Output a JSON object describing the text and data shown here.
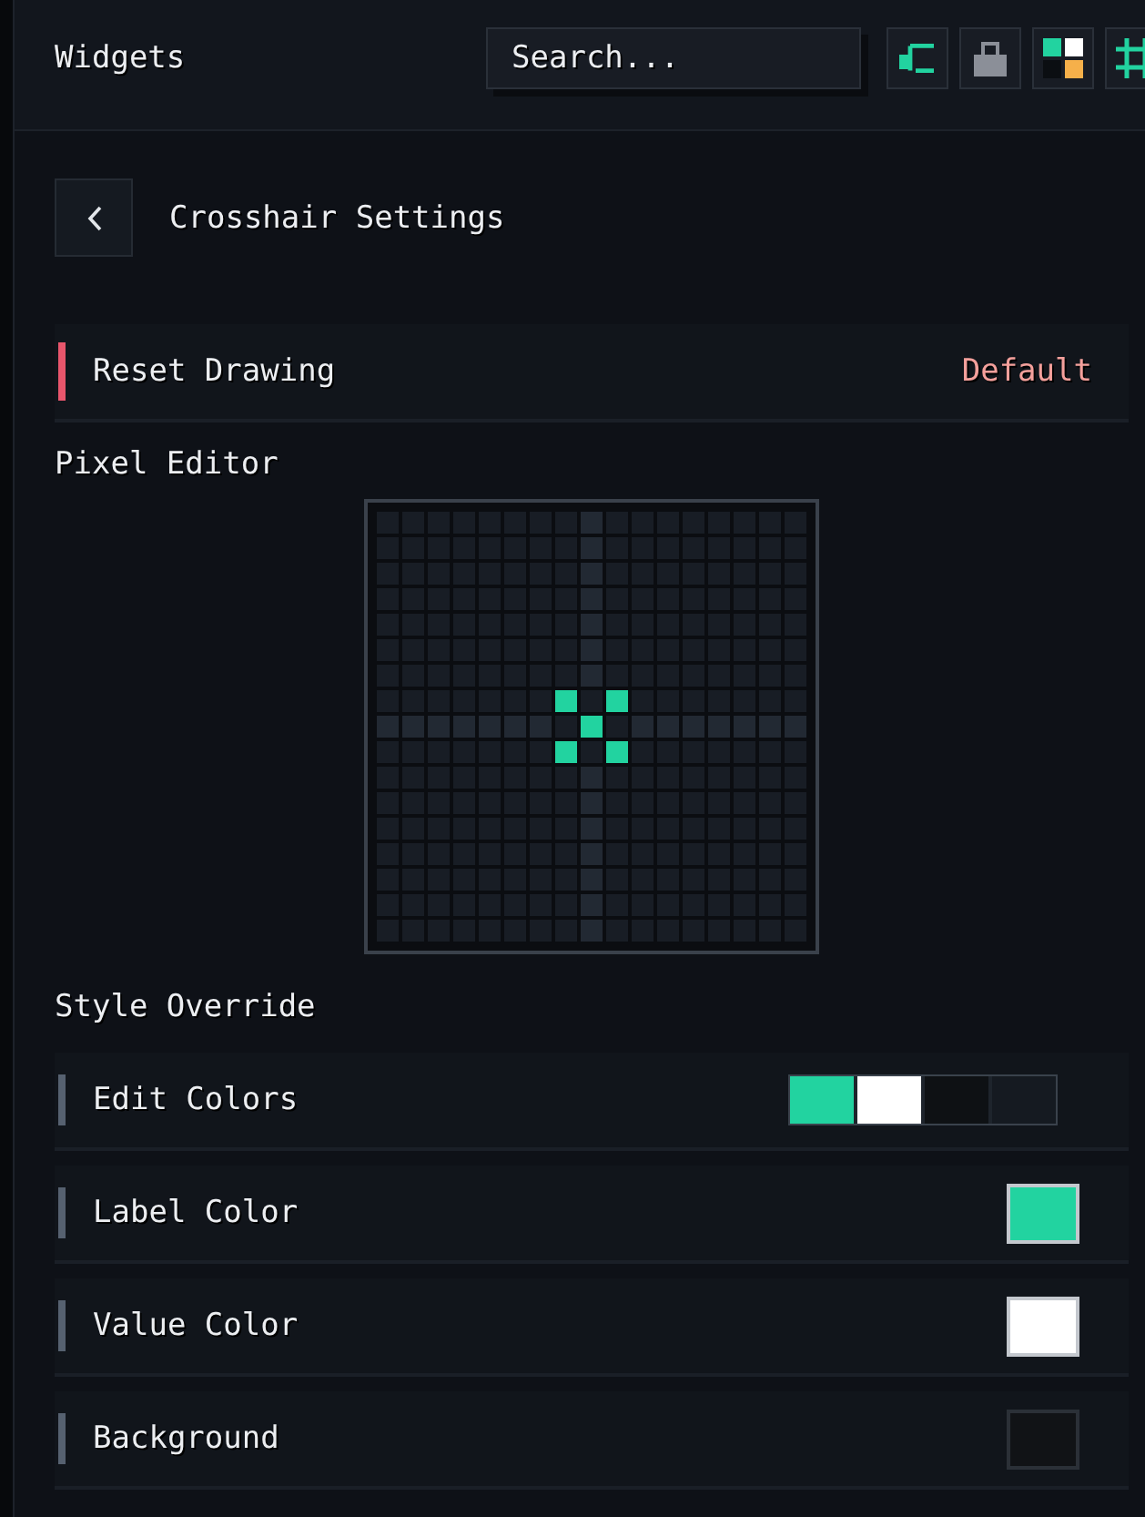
{
  "header": {
    "title": "Widgets",
    "search": {
      "placeholder": "Search..."
    },
    "tools": [
      {
        "kind": "connector"
      },
      {
        "kind": "lock"
      },
      {
        "kind": "tiles"
      },
      {
        "kind": "grid"
      }
    ]
  },
  "page": {
    "title": "Crosshair Settings"
  },
  "reset_row": {
    "label": "Reset Drawing",
    "action": "Default"
  },
  "pixel_editor": {
    "label": "Pixel Editor",
    "rows": [
      {
        "cells": [
          {
            "on": false
          },
          {
            "on": false
          },
          {
            "on": false
          },
          {
            "on": false
          },
          {
            "on": false
          },
          {
            "on": false
          },
          {
            "on": false
          },
          {
            "on": false
          },
          {
            "on": false
          },
          {
            "on": false
          },
          {
            "on": false
          },
          {
            "on": false
          },
          {
            "on": false
          },
          {
            "on": false
          },
          {
            "on": false
          },
          {
            "on": false
          },
          {
            "on": false
          }
        ]
      },
      {
        "cells": [
          {
            "on": false
          },
          {
            "on": false
          },
          {
            "on": false
          },
          {
            "on": false
          },
          {
            "on": false
          },
          {
            "on": false
          },
          {
            "on": false
          },
          {
            "on": false
          },
          {
            "on": false
          },
          {
            "on": false
          },
          {
            "on": false
          },
          {
            "on": false
          },
          {
            "on": false
          },
          {
            "on": false
          },
          {
            "on": false
          },
          {
            "on": false
          },
          {
            "on": false
          }
        ]
      },
      {
        "cells": [
          {
            "on": false
          },
          {
            "on": false
          },
          {
            "on": false
          },
          {
            "on": false
          },
          {
            "on": false
          },
          {
            "on": false
          },
          {
            "on": false
          },
          {
            "on": false
          },
          {
            "on": false
          },
          {
            "on": false
          },
          {
            "on": false
          },
          {
            "on": false
          },
          {
            "on": false
          },
          {
            "on": false
          },
          {
            "on": false
          },
          {
            "on": false
          },
          {
            "on": false
          }
        ]
      },
      {
        "cells": [
          {
            "on": false
          },
          {
            "on": false
          },
          {
            "on": false
          },
          {
            "on": false
          },
          {
            "on": false
          },
          {
            "on": false
          },
          {
            "on": false
          },
          {
            "on": false
          },
          {
            "on": false
          },
          {
            "on": false
          },
          {
            "on": false
          },
          {
            "on": false
          },
          {
            "on": false
          },
          {
            "on": false
          },
          {
            "on": false
          },
          {
            "on": false
          },
          {
            "on": false
          }
        ]
      },
      {
        "cells": [
          {
            "on": false
          },
          {
            "on": false
          },
          {
            "on": false
          },
          {
            "on": false
          },
          {
            "on": false
          },
          {
            "on": false
          },
          {
            "on": false
          },
          {
            "on": false
          },
          {
            "on": false
          },
          {
            "on": false
          },
          {
            "on": false
          },
          {
            "on": false
          },
          {
            "on": false
          },
          {
            "on": false
          },
          {
            "on": false
          },
          {
            "on": false
          },
          {
            "on": false
          }
        ]
      },
      {
        "cells": [
          {
            "on": false
          },
          {
            "on": false
          },
          {
            "on": false
          },
          {
            "on": false
          },
          {
            "on": false
          },
          {
            "on": false
          },
          {
            "on": false
          },
          {
            "on": false
          },
          {
            "on": false
          },
          {
            "on": false
          },
          {
            "on": false
          },
          {
            "on": false
          },
          {
            "on": false
          },
          {
            "on": false
          },
          {
            "on": false
          },
          {
            "on": false
          },
          {
            "on": false
          }
        ]
      },
      {
        "cells": [
          {
            "on": false
          },
          {
            "on": false
          },
          {
            "on": false
          },
          {
            "on": false
          },
          {
            "on": false
          },
          {
            "on": false
          },
          {
            "on": false
          },
          {
            "on": false
          },
          {
            "on": false
          },
          {
            "on": false
          },
          {
            "on": false
          },
          {
            "on": false
          },
          {
            "on": false
          },
          {
            "on": false
          },
          {
            "on": false
          },
          {
            "on": false
          },
          {
            "on": false
          }
        ]
      },
      {
        "cells": [
          {
            "on": false
          },
          {
            "on": false
          },
          {
            "on": false
          },
          {
            "on": false
          },
          {
            "on": false
          },
          {
            "on": false
          },
          {
            "on": false
          },
          {
            "on": true
          },
          {
            "on": false
          },
          {
            "on": true
          },
          {
            "on": false
          },
          {
            "on": false
          },
          {
            "on": false
          },
          {
            "on": false
          },
          {
            "on": false
          },
          {
            "on": false
          },
          {
            "on": false
          }
        ]
      },
      {
        "cells": [
          {
            "on": false
          },
          {
            "on": false
          },
          {
            "on": false
          },
          {
            "on": false
          },
          {
            "on": false
          },
          {
            "on": false
          },
          {
            "on": false
          },
          {
            "on": false
          },
          {
            "on": true
          },
          {
            "on": false
          },
          {
            "on": false
          },
          {
            "on": false
          },
          {
            "on": false
          },
          {
            "on": false
          },
          {
            "on": false
          },
          {
            "on": false
          },
          {
            "on": false
          }
        ]
      },
      {
        "cells": [
          {
            "on": false
          },
          {
            "on": false
          },
          {
            "on": false
          },
          {
            "on": false
          },
          {
            "on": false
          },
          {
            "on": false
          },
          {
            "on": false
          },
          {
            "on": true
          },
          {
            "on": false
          },
          {
            "on": true
          },
          {
            "on": false
          },
          {
            "on": false
          },
          {
            "on": false
          },
          {
            "on": false
          },
          {
            "on": false
          },
          {
            "on": false
          },
          {
            "on": false
          }
        ]
      },
      {
        "cells": [
          {
            "on": false
          },
          {
            "on": false
          },
          {
            "on": false
          },
          {
            "on": false
          },
          {
            "on": false
          },
          {
            "on": false
          },
          {
            "on": false
          },
          {
            "on": false
          },
          {
            "on": false
          },
          {
            "on": false
          },
          {
            "on": false
          },
          {
            "on": false
          },
          {
            "on": false
          },
          {
            "on": false
          },
          {
            "on": false
          },
          {
            "on": false
          },
          {
            "on": false
          }
        ]
      },
      {
        "cells": [
          {
            "on": false
          },
          {
            "on": false
          },
          {
            "on": false
          },
          {
            "on": false
          },
          {
            "on": false
          },
          {
            "on": false
          },
          {
            "on": false
          },
          {
            "on": false
          },
          {
            "on": false
          },
          {
            "on": false
          },
          {
            "on": false
          },
          {
            "on": false
          },
          {
            "on": false
          },
          {
            "on": false
          },
          {
            "on": false
          },
          {
            "on": false
          },
          {
            "on": false
          }
        ]
      },
      {
        "cells": [
          {
            "on": false
          },
          {
            "on": false
          },
          {
            "on": false
          },
          {
            "on": false
          },
          {
            "on": false
          },
          {
            "on": false
          },
          {
            "on": false
          },
          {
            "on": false
          },
          {
            "on": false
          },
          {
            "on": false
          },
          {
            "on": false
          },
          {
            "on": false
          },
          {
            "on": false
          },
          {
            "on": false
          },
          {
            "on": false
          },
          {
            "on": false
          },
          {
            "on": false
          }
        ]
      },
      {
        "cells": [
          {
            "on": false
          },
          {
            "on": false
          },
          {
            "on": false
          },
          {
            "on": false
          },
          {
            "on": false
          },
          {
            "on": false
          },
          {
            "on": false
          },
          {
            "on": false
          },
          {
            "on": false
          },
          {
            "on": false
          },
          {
            "on": false
          },
          {
            "on": false
          },
          {
            "on": false
          },
          {
            "on": false
          },
          {
            "on": false
          },
          {
            "on": false
          },
          {
            "on": false
          }
        ]
      },
      {
        "cells": [
          {
            "on": false
          },
          {
            "on": false
          },
          {
            "on": false
          },
          {
            "on": false
          },
          {
            "on": false
          },
          {
            "on": false
          },
          {
            "on": false
          },
          {
            "on": false
          },
          {
            "on": false
          },
          {
            "on": false
          },
          {
            "on": false
          },
          {
            "on": false
          },
          {
            "on": false
          },
          {
            "on": false
          },
          {
            "on": false
          },
          {
            "on": false
          },
          {
            "on": false
          }
        ]
      },
      {
        "cells": [
          {
            "on": false
          },
          {
            "on": false
          },
          {
            "on": false
          },
          {
            "on": false
          },
          {
            "on": false
          },
          {
            "on": false
          },
          {
            "on": false
          },
          {
            "on": false
          },
          {
            "on": false
          },
          {
            "on": false
          },
          {
            "on": false
          },
          {
            "on": false
          },
          {
            "on": false
          },
          {
            "on": false
          },
          {
            "on": false
          },
          {
            "on": false
          },
          {
            "on": false
          }
        ]
      },
      {
        "cells": [
          {
            "on": false
          },
          {
            "on": false
          },
          {
            "on": false
          },
          {
            "on": false
          },
          {
            "on": false
          },
          {
            "on": false
          },
          {
            "on": false
          },
          {
            "on": false
          },
          {
            "on": false
          },
          {
            "on": false
          },
          {
            "on": false
          },
          {
            "on": false
          },
          {
            "on": false
          },
          {
            "on": false
          },
          {
            "on": false
          },
          {
            "on": false
          },
          {
            "on": false
          }
        ]
      }
    ]
  },
  "style_override": {
    "label": "Style Override",
    "items": [
      {
        "kind": "palette",
        "label": "Edit Colors",
        "swatches": [
          {
            "color": "#22d3a0"
          },
          {
            "color": "#ffffff"
          },
          {
            "color": "#0e1114"
          },
          {
            "color": "#151a21"
          }
        ]
      },
      {
        "kind": "color",
        "label": "Label Color",
        "color": "#22d3a0"
      },
      {
        "kind": "color",
        "label": "Value Color",
        "color": "#ffffff"
      },
      {
        "kind": "color",
        "label": "Background",
        "color": "#111316"
      }
    ]
  }
}
